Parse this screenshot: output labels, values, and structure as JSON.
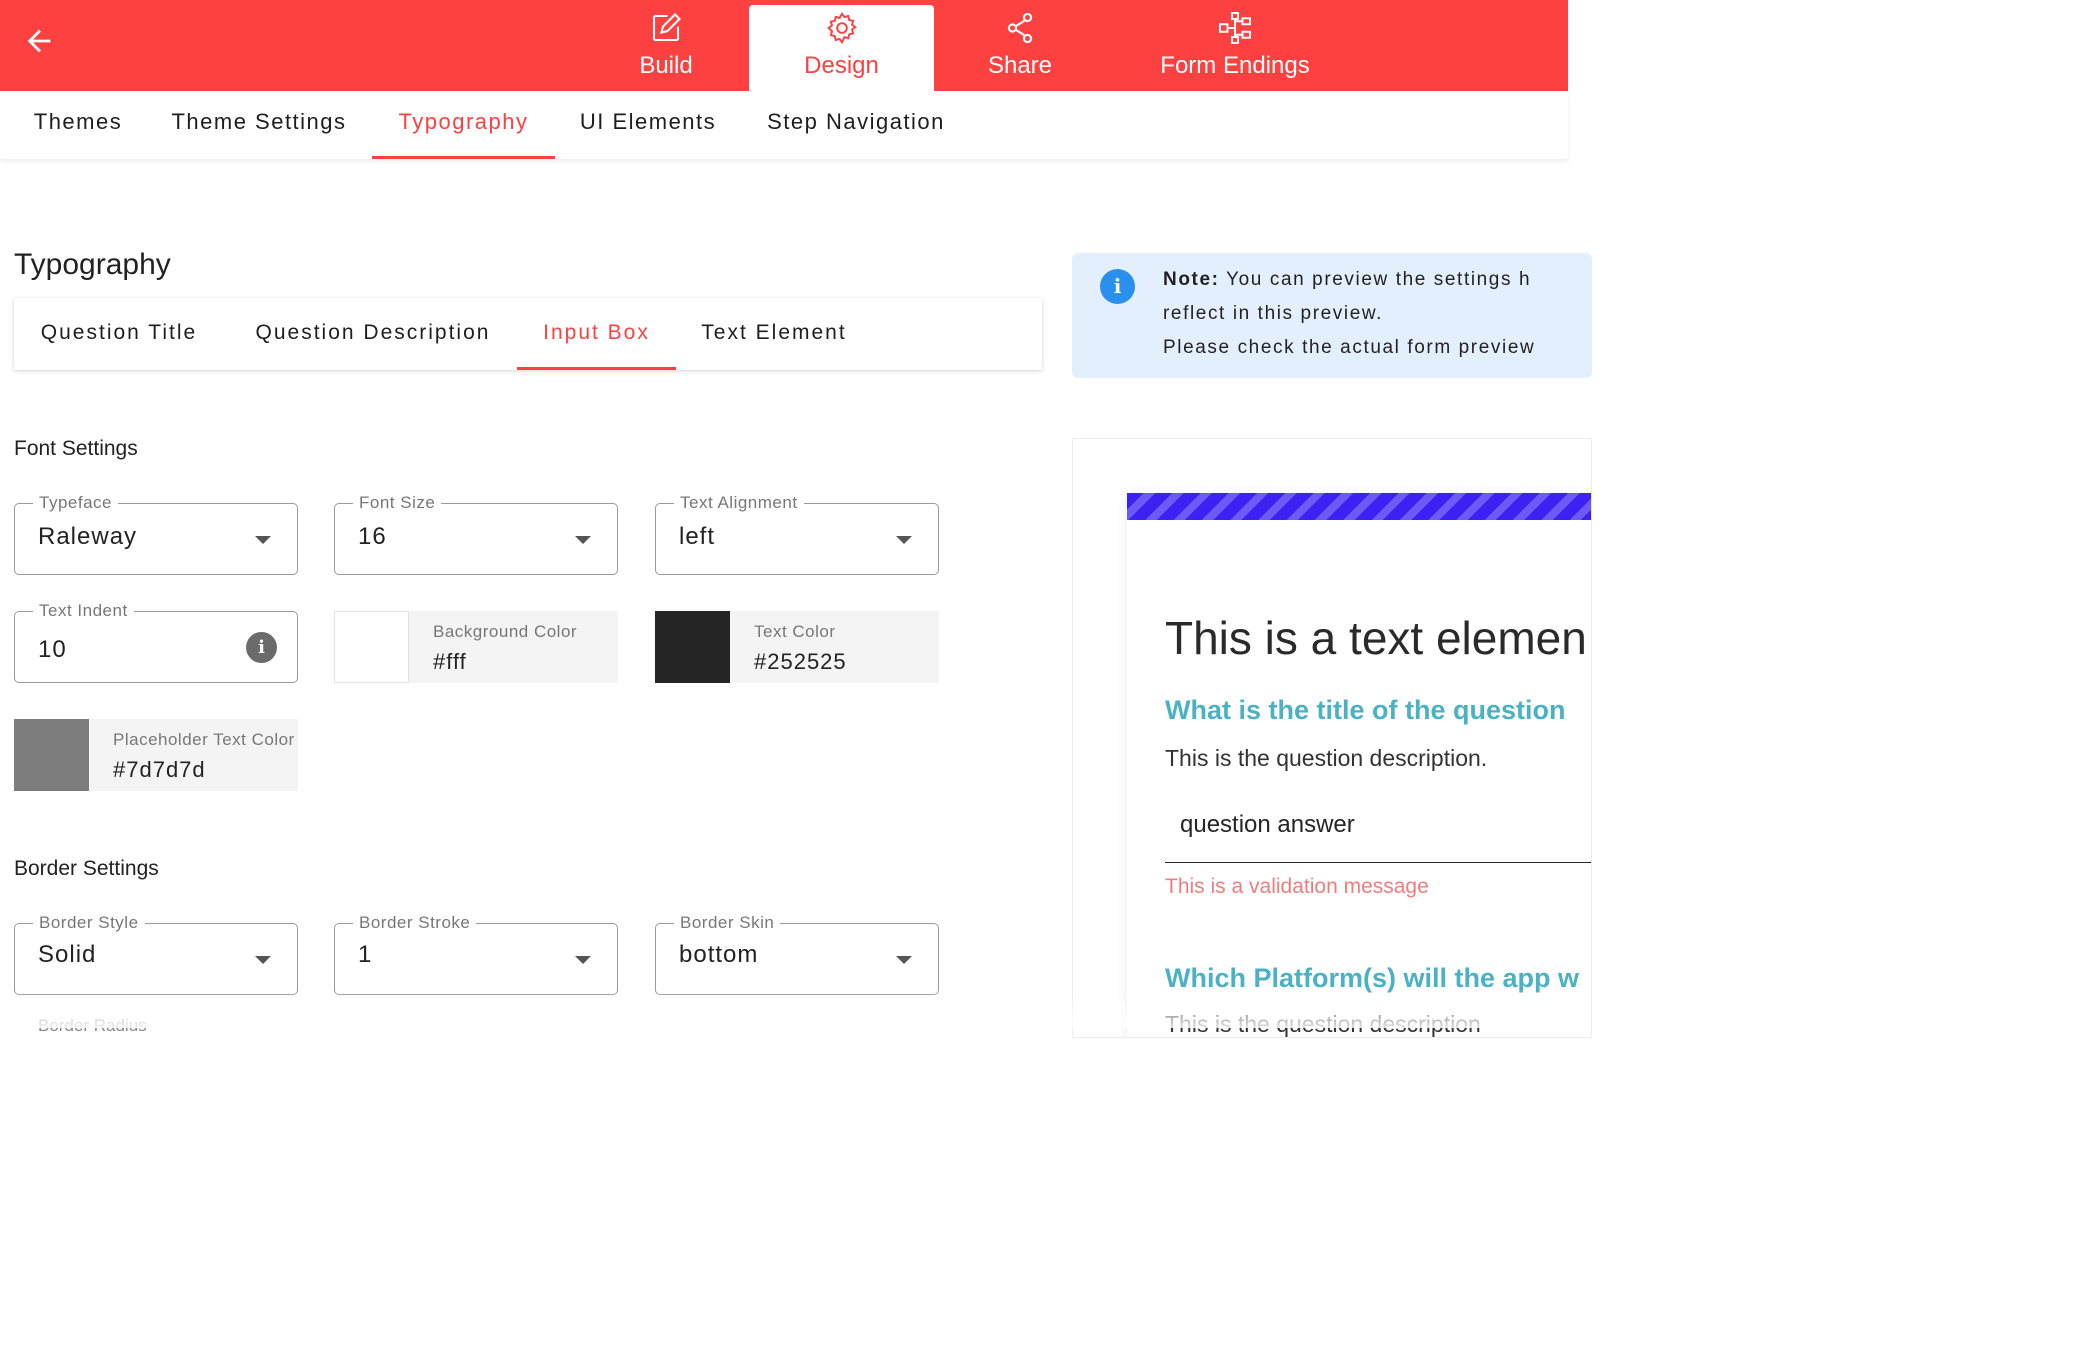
{
  "topnav": {
    "tabs": [
      {
        "label": "Build",
        "icon": "edit-icon"
      },
      {
        "label": "Design",
        "icon": "gear-icon",
        "active": true
      },
      {
        "label": "Share",
        "icon": "share-icon"
      },
      {
        "label": "Form Endings",
        "icon": "sitemap-icon"
      }
    ],
    "bar_color": "#fd4040"
  },
  "subnav": {
    "tabs": [
      "Themes",
      "Theme Settings",
      "Typography",
      "UI Elements",
      "Step Navigation"
    ],
    "active": "Typography"
  },
  "page": {
    "title": "Typography",
    "tabs": [
      "Question Title",
      "Question Description",
      "Input Box",
      "Text Element"
    ],
    "active_tab": "Input Box"
  },
  "font_settings": {
    "heading": "Font Settings",
    "typeface": {
      "label": "Typeface",
      "value": "Raleway"
    },
    "font_size": {
      "label": "Font Size",
      "value": "16"
    },
    "text_alignment": {
      "label": "Text Alignment",
      "value": "left"
    },
    "text_indent": {
      "label": "Text Indent",
      "value": "10"
    },
    "background_color": {
      "label": "Background Color",
      "value": "#fff"
    },
    "text_color": {
      "label": "Text Color",
      "value": "#252525"
    },
    "placeholder_text_color": {
      "label": "Placeholder Text Color",
      "value": "#7d7d7d"
    }
  },
  "border_settings": {
    "heading": "Border Settings",
    "border_style": {
      "label": "Border Style",
      "value": "Solid"
    },
    "border_stroke": {
      "label": "Border Stroke",
      "value": "1"
    },
    "border_skin": {
      "label": "Border Skin",
      "value": "bottom"
    },
    "border_radius": {
      "label": "Border Radius"
    }
  },
  "note": {
    "bold": "Note:",
    "line1": " You can preview the settings h",
    "line2": "reflect in this preview.",
    "line3": "Please check the actual form preview"
  },
  "preview": {
    "heading": "This is a text elemen",
    "question1": "What is the title of the question",
    "description1": "This is the question description.",
    "answer": "question answer",
    "validation": "This is a validation message",
    "question2": "Which Platform(s) will the app w",
    "description2": "This is the question description"
  }
}
